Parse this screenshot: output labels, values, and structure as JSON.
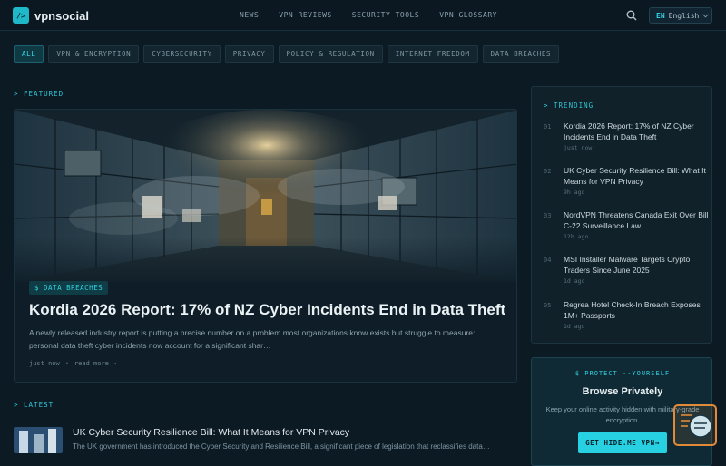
{
  "brand": {
    "logo_mark": "/>",
    "name": "vpnsocial"
  },
  "nav": [
    "NEWS",
    "VPN REVIEWS",
    "SECURITY TOOLS",
    "VPN GLOSSARY"
  ],
  "language": {
    "code": "EN",
    "name": "English",
    "icon": "chevron-down-icon"
  },
  "filters": [
    "ALL",
    "VPN & ENCRYPTION",
    "CYBERSECURITY",
    "PRIVACY",
    "POLICY & REGULATION",
    "INTERNET FREEDOM",
    "DATA BREACHES"
  ],
  "featured": {
    "section_label": "> FEATURED",
    "tag": "$ DATA BREACHES",
    "title": "Kordia 2026 Report: 17% of NZ Cyber Incidents End in Data Theft",
    "excerpt": "A newly released industry report is putting a precise number on a problem most organizations know exists but struggle to measure: personal data theft cyber incidents now account for a significant shar…",
    "time": "just now",
    "dot": "•",
    "read_more": "read more →"
  },
  "latest": {
    "section_label": "> LATEST",
    "title": "UK Cyber Security Resilience Bill: What It Means for VPN Privacy",
    "excerpt": "The UK government has introduced the Cyber Security and Resilience Bill, a significant piece of legislation that reclassifies data…"
  },
  "trending": {
    "label": "> TRENDING",
    "items": [
      {
        "num": "01",
        "title": "Kordia 2026 Report: 17% of NZ Cyber Incidents End in Data Theft",
        "time": "just now"
      },
      {
        "num": "02",
        "title": "UK Cyber Security Resilience Bill: What It Means for VPN Privacy",
        "time": "9h ago"
      },
      {
        "num": "03",
        "title": "NordVPN Threatens Canada Exit Over Bill C-22 Surveillance Law",
        "time": "12h ago"
      },
      {
        "num": "04",
        "title": "MSI Installer Malware Targets Crypto Traders Since June 2025",
        "time": "1d ago"
      },
      {
        "num": "05",
        "title": "Regrea Hotel Check-In Breach Exposes 1M+ Passports",
        "time": "1d ago"
      }
    ]
  },
  "promo": {
    "kicker": "$ PROTECT --YOURSELF",
    "title": "Browse Privately",
    "desc": "Keep your online activity hidden with military-grade encryption.",
    "button": "GET HIDE.ME VPN→"
  },
  "colors": {
    "accent": "#2fd0e0",
    "background": "#0c1a24",
    "float_widget_border": "#e08a3a"
  }
}
